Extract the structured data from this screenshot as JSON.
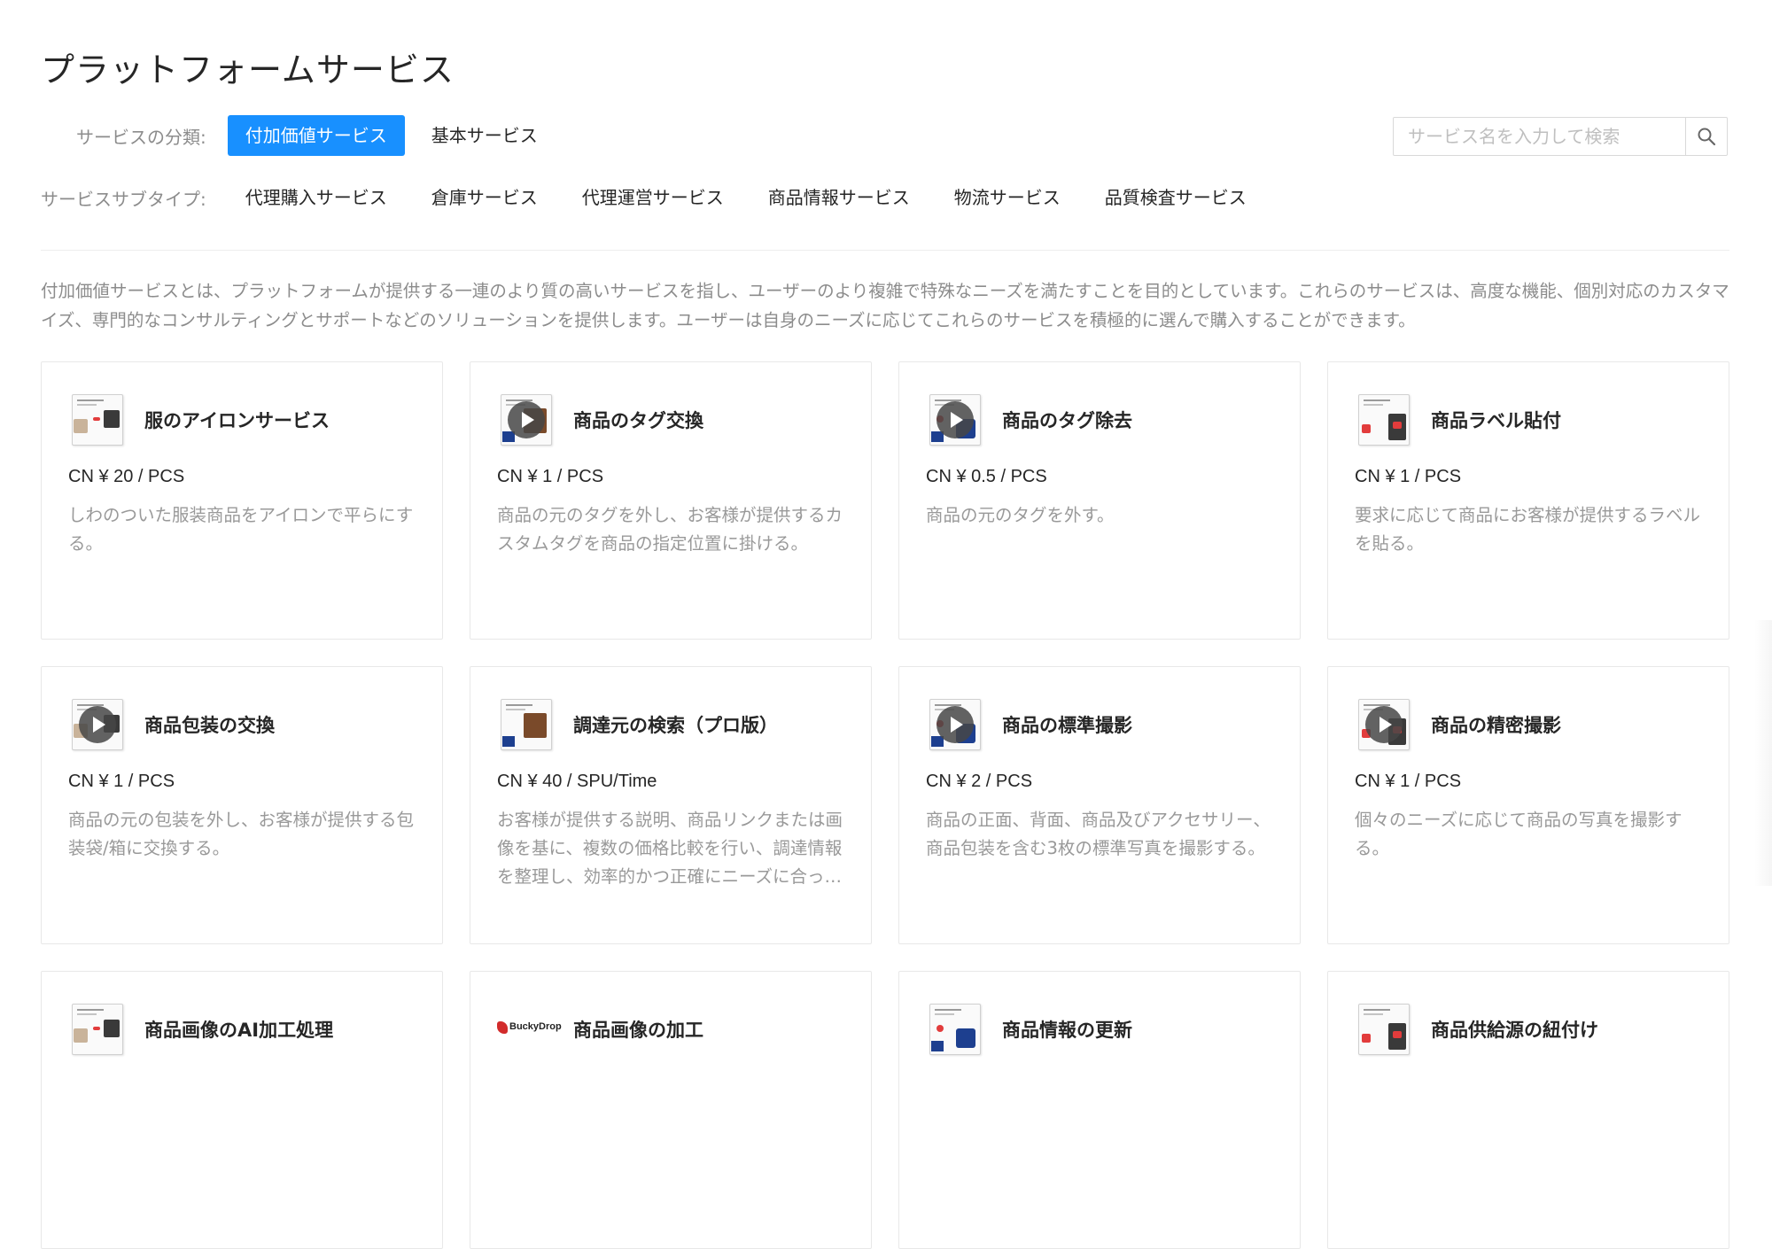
{
  "page": {
    "title": "プラットフォームサービス",
    "description": "付加価値サービスとは、プラットフォームが提供する一連のより質の高いサービスを指し、ユーザーのより複雑で特殊なニーズを満たすことを目的としています。これらのサービスは、高度な機能、個別対応のカスタマイズ、専門的なコンサルティングとサポートなどのソリューションを提供します。ユーザーは自身のニーズに応じてこれらのサービスを積極的に選んで購入することができます。"
  },
  "filters": {
    "category_label": "サービスの分類:",
    "categories": [
      {
        "label": "付加価値サービス",
        "active": true
      },
      {
        "label": "基本サービス",
        "active": false
      }
    ],
    "subtype_label": "サービスサブタイプ:",
    "subtypes": [
      "代理購入サービス",
      "倉庫サービス",
      "代理運営サービス",
      "商品情報サービス",
      "物流サービス",
      "品質検査サービス"
    ]
  },
  "search": {
    "placeholder": "サービス名を入力して検索",
    "icon": "search-icon"
  },
  "colors": {
    "accent": "#1890ff",
    "muted_text": "#8c8c8c",
    "desc_text": "#999999",
    "border": "#e8e8e8"
  },
  "services": [
    {
      "title": "服のアイロンサービス",
      "price": "CN ¥ 20 / PCS",
      "desc": "しわのついた服装商品をアイロンで平らにする。",
      "thumb": "doc",
      "video": false
    },
    {
      "title": "商品のタグ交換",
      "price": "CN ¥ 1 / PCS",
      "desc": "商品の元のタグを外し、お客様が提供するカスタムタグを商品の指定位置に掛ける。",
      "thumb": "doc",
      "video": true
    },
    {
      "title": "商品のタグ除去",
      "price": "CN ¥ 0.5 / PCS",
      "desc": "商品の元のタグを外す。",
      "thumb": "doc",
      "video": true
    },
    {
      "title": "商品ラベル貼付",
      "price": "CN ¥ 1 / PCS",
      "desc": "要求に応じて商品にお客様が提供するラベルを貼る。",
      "thumb": "doc",
      "video": false
    },
    {
      "title": "商品包装の交換",
      "price": "CN ¥ 1 / PCS",
      "desc": "商品の元の包装を外し、お客様が提供する包装袋/箱に交換する。",
      "thumb": "doc",
      "video": true
    },
    {
      "title": "調達元の検索（プロ版）",
      "price": "CN ¥ 40 / SPU/Time",
      "desc": "お客様が提供する説明、商品リンクまたは画像を基に、複数の価格比較を行い、調達情報を整理し、効率的かつ正確にニーズに合った調達元を見つける。",
      "thumb": "doc",
      "video": false
    },
    {
      "title": "商品の標準撮影",
      "price": "CN ¥ 2 / PCS",
      "desc": "商品の正面、背面、商品及びアクセサリー、商品包装を含む3枚の標準写真を撮影する。",
      "thumb": "doc",
      "video": true
    },
    {
      "title": "商品の精密撮影",
      "price": "CN ¥ 1 / PCS",
      "desc": "個々のニーズに応じて商品の写真を撮影する。",
      "thumb": "doc",
      "video": true
    },
    {
      "title": "商品画像のAI加工処理",
      "price": "",
      "desc": "",
      "thumb": "doc",
      "video": false
    },
    {
      "title": "商品画像の加工",
      "price": "",
      "desc": "",
      "thumb": "logo",
      "logo_text": "BuckyDrop",
      "video": false
    },
    {
      "title": "商品情報の更新",
      "price": "",
      "desc": "",
      "thumb": "doc",
      "video": false
    },
    {
      "title": "商品供給源の紐付け",
      "price": "",
      "desc": "",
      "thumb": "doc",
      "video": false
    }
  ]
}
